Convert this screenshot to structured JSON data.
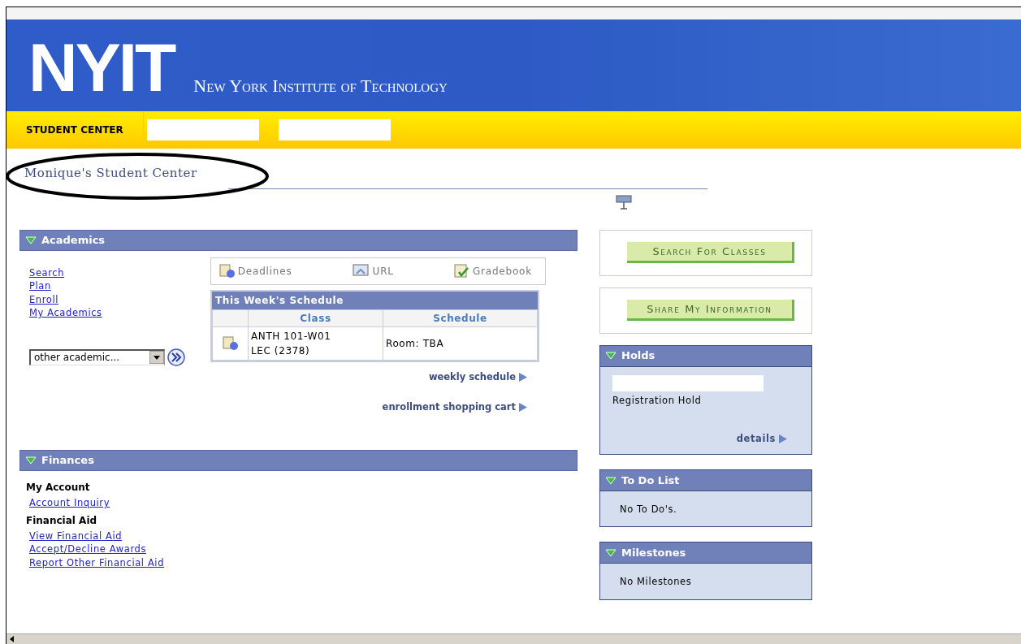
{
  "header": {
    "logo": "NYIT",
    "institution": "New York Institute of Technology"
  },
  "nav_tabs": [
    {
      "label": "STUDENT CENTER",
      "selected": true
    }
  ],
  "page_title": "Monique's Student Center",
  "academics": {
    "title": "Academics",
    "expanded": true,
    "links": [
      "Search",
      "Plan",
      "Enroll",
      "My Academics"
    ],
    "dropdown": {
      "value": "other academic..."
    },
    "toolbar": [
      {
        "label": "Deadlines",
        "kind": "deadlines"
      },
      {
        "label": "URL",
        "kind": "url"
      },
      {
        "label": "Gradebook",
        "kind": "gradebook"
      }
    ],
    "schedule": {
      "title": "This Week's Schedule",
      "columns": [
        "Class",
        "Schedule"
      ],
      "rows": [
        {
          "class_lines": [
            "ANTH 101-W01",
            "LEC (2378)"
          ],
          "schedule": "Room:  TBA"
        }
      ]
    },
    "links_below": [
      "weekly schedule",
      "enrollment shopping cart"
    ]
  },
  "finances": {
    "title": "Finances",
    "expanded": true,
    "groups": [
      {
        "heading": "My Account",
        "links": [
          "Account Inquiry"
        ]
      },
      {
        "heading": "Financial Aid",
        "links": [
          "View Financial Aid",
          "Accept/Decline Awards",
          "Report Other Financial Aid"
        ]
      }
    ]
  },
  "buttons": [
    "Search For Classes",
    "Share My Information"
  ],
  "holds": {
    "title": "Holds",
    "expanded": true,
    "items": [
      "Registration Hold"
    ],
    "link": "details"
  },
  "todo": {
    "title": "To Do List",
    "expanded": true,
    "message": "No To Do's."
  },
  "milestones": {
    "title": "Milestones",
    "expanded": true,
    "message": "No Milestones"
  }
}
